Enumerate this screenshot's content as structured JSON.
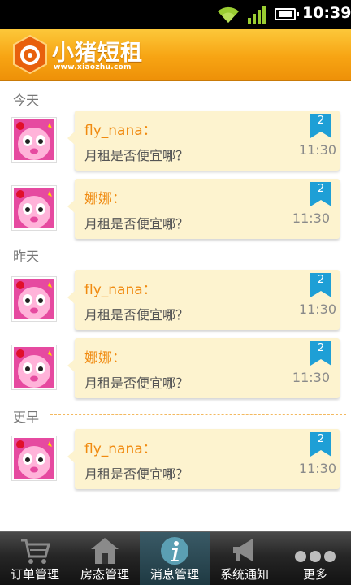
{
  "status_bar": {
    "time": "10:39",
    "icons": [
      "wifi-icon",
      "signal-icon",
      "battery-icon"
    ]
  },
  "header": {
    "brand_name": "小猪短租",
    "brand_url": "www.xiaozhu.com",
    "background": "#f7a413"
  },
  "sections": [
    {
      "label": "今天",
      "messages": [
        {
          "sender": "fly_nana：",
          "text": "月租是否便宜哪？",
          "time": "11:30",
          "badge": "2"
        },
        {
          "sender": "娜娜：",
          "text": "月租是否便宜哪？",
          "time": "11:30",
          "badge": "2"
        }
      ]
    },
    {
      "label": "昨天",
      "messages": [
        {
          "sender": "fly_nana：",
          "text": "月租是否便宜哪？",
          "time": "11:30",
          "badge": "2"
        },
        {
          "sender": "娜娜：",
          "text": "月租是否便宜哪？",
          "time": "11:30",
          "badge": "2"
        }
      ]
    },
    {
      "label": "更早",
      "messages": [
        {
          "sender": "fly_nana：",
          "text": "月租是否便宜哪？",
          "time": "11:30",
          "badge": "2"
        }
      ]
    }
  ],
  "tabs": [
    {
      "label": "订单管理",
      "icon": "cart-icon",
      "active": false
    },
    {
      "label": "房态管理",
      "icon": "house-icon",
      "active": false
    },
    {
      "label": "消息管理",
      "icon": "info-icon",
      "active": true
    },
    {
      "label": "系统通知",
      "icon": "megaphone-icon",
      "active": false
    },
    {
      "label": "更多",
      "icon": "more-icon",
      "active": false
    }
  ],
  "colors": {
    "accent": "#f08a10",
    "bubble": "#fdf3cf",
    "badge": "#1e9fd6",
    "tab_active": "#2e4f5a"
  }
}
